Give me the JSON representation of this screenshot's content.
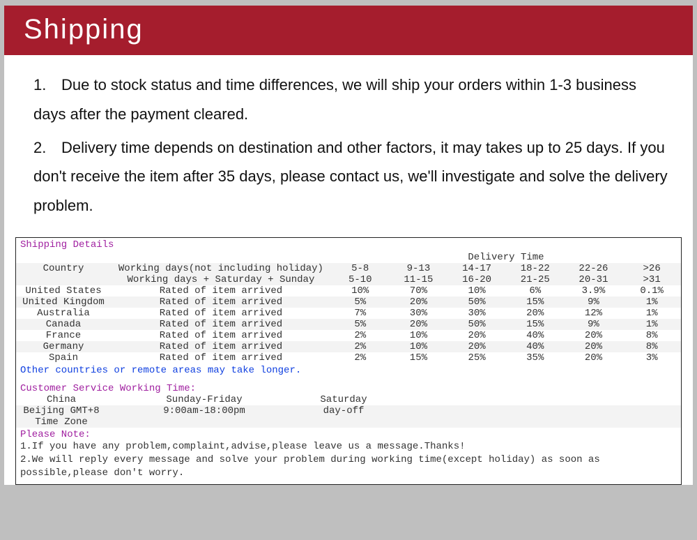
{
  "header": {
    "title": "Shipping"
  },
  "intro": {
    "p1_num": "1.",
    "p1": "Due to stock status and time differences, we will ship your orders within 1-3 business days after the payment cleared.",
    "p2_num": "2.",
    "p2": "Delivery time depends on destination and other factors, it may takes up to 25 days. If you don't receive the item after 35 days, please contact us, we'll investigate and solve the delivery problem."
  },
  "details": {
    "title": "Shipping Details",
    "delivery_time_label": "Delivery Time",
    "col_country": "Country",
    "row_wd_label": "Working days(not including holiday)",
    "row_wd_vals": [
      "5-8",
      "9-13",
      "14-17",
      "18-22",
      "22-26",
      ">26"
    ],
    "row_ws_label": "Working days + Saturday + Sunday",
    "row_ws_vals": [
      "5-10",
      "11-15",
      "16-20",
      "21-25",
      "20-31",
      ">31"
    ],
    "rated_label": "Rated of item arrived",
    "rows": [
      {
        "country": "United States",
        "vals": [
          "10%",
          "70%",
          "10%",
          "6%",
          "3.9%",
          "0.1%"
        ]
      },
      {
        "country": "United Kingdom",
        "vals": [
          "5%",
          "20%",
          "50%",
          "15%",
          "9%",
          "1%"
        ]
      },
      {
        "country": "Australia",
        "vals": [
          "7%",
          "30%",
          "30%",
          "20%",
          "12%",
          "1%"
        ]
      },
      {
        "country": "Canada",
        "vals": [
          "5%",
          "20%",
          "50%",
          "15%",
          "9%",
          "1%"
        ]
      },
      {
        "country": "France",
        "vals": [
          "2%",
          "10%",
          "20%",
          "40%",
          "20%",
          "8%"
        ]
      },
      {
        "country": "Germany",
        "vals": [
          "2%",
          "10%",
          "20%",
          "40%",
          "20%",
          "8%"
        ]
      },
      {
        "country": "Spain",
        "vals": [
          "2%",
          "15%",
          "25%",
          "35%",
          "20%",
          "3%"
        ]
      }
    ],
    "other_note": "Other countries or remote areas may take longer."
  },
  "cs": {
    "title": "Customer Service Working Time:",
    "col_region": "China",
    "col_period1": "Sunday-Friday",
    "col_period2": "Saturday",
    "tz_line1": "Beijing GMT+8",
    "tz_line2": "Time Zone",
    "hours": "9:00am-18:00pm",
    "dayoff": "day-off"
  },
  "please_note": {
    "title": "Please Note:",
    "n1": "1.If you have any problem,complaint,advise,please leave us a message.Thanks!",
    "n2": "2.We will reply every message and solve your problem during working time(except holiday) as soon as possible,please don't worry."
  }
}
